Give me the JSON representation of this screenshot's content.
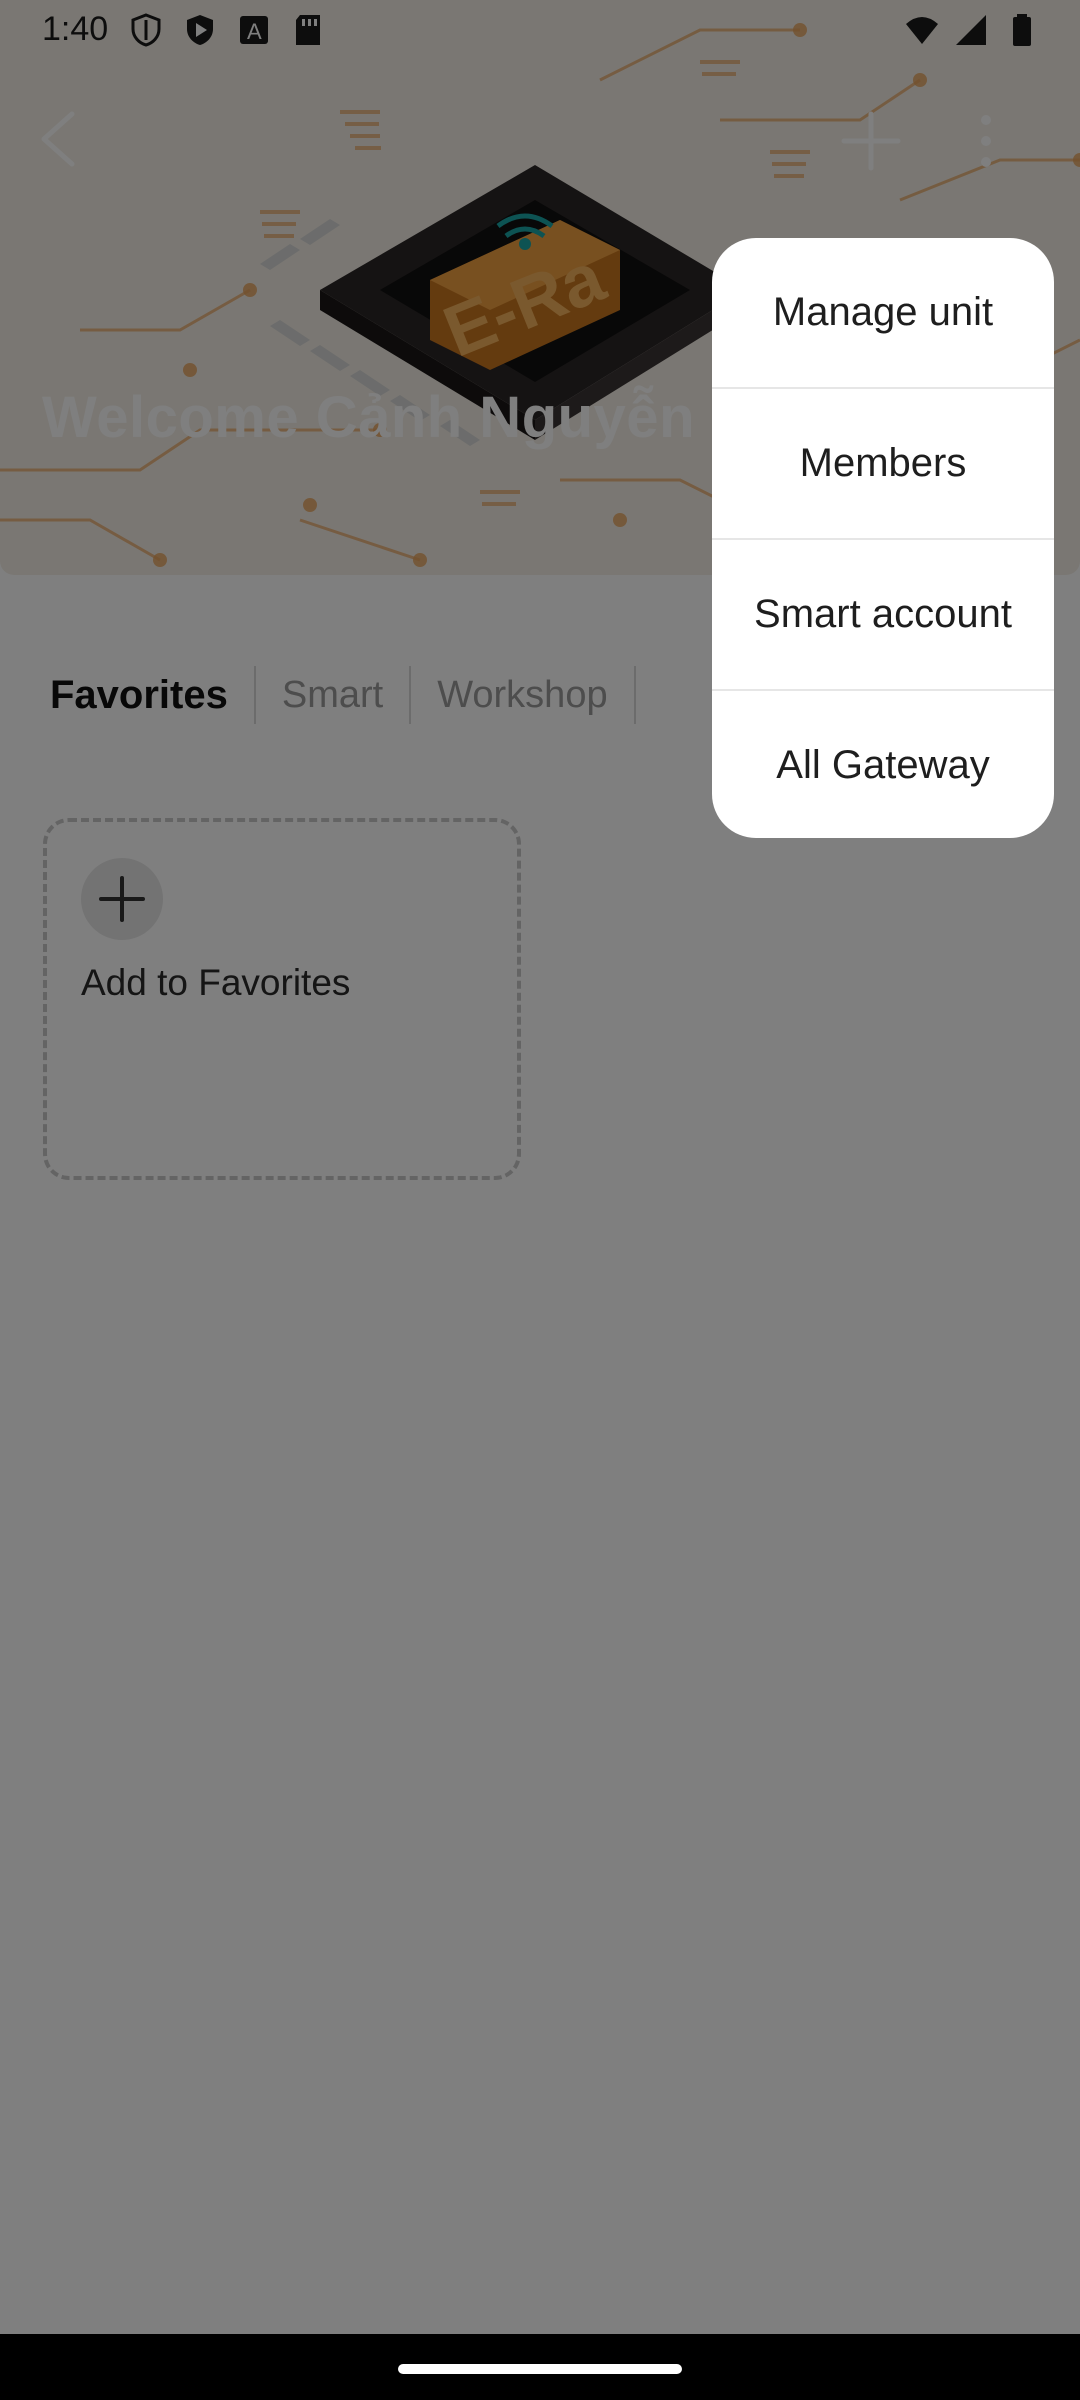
{
  "status_bar": {
    "time": "1:40",
    "left_icons": [
      "shield-icon",
      "play-store-icon",
      "font-a-icon",
      "sd-card-icon"
    ],
    "right_icons": [
      "wifi-icon",
      "cellular-icon",
      "battery-icon"
    ]
  },
  "header": {
    "welcome_text": "Welcome Cảnh Nguyễn",
    "logo_text": "E-Ra",
    "back_icon": "chevron-left-icon",
    "add_icon": "plus-icon",
    "more_icon": "more-vertical-icon"
  },
  "tabs": [
    {
      "label": "Favorites",
      "active": true
    },
    {
      "label": "Smart",
      "active": false
    },
    {
      "label": "Workshop",
      "active": false
    }
  ],
  "favorites_card": {
    "label": "Add to Favorites",
    "icon": "plus-icon"
  },
  "menu": {
    "items": [
      {
        "label": "Manage unit"
      },
      {
        "label": "Members"
      },
      {
        "label": "Smart account"
      },
      {
        "label": "All Gateway"
      }
    ]
  },
  "colors": {
    "accent_orange": "#e8922b",
    "scrim": "#000000",
    "menu_background": "#ffffff"
  }
}
